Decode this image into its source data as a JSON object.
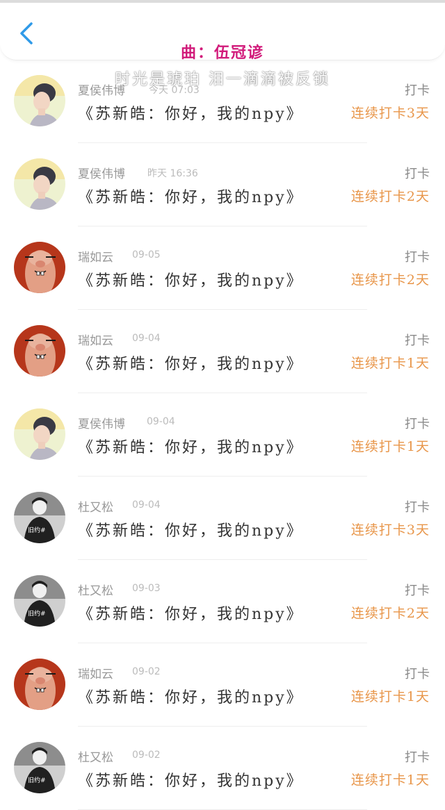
{
  "header": {
    "song_title": "曲：伍冠谚",
    "lyric": "时光是琥珀 泪一滴滴被反锁"
  },
  "rows": [
    {
      "name": "夏侯伟博",
      "time": "今天 07:03",
      "checkin": "打卡",
      "message": "《苏新皓：你好，我的npy》",
      "streak": "连续打卡3天",
      "avatar": "girl"
    },
    {
      "name": "夏侯伟博",
      "time": "昨天 16:36",
      "checkin": "打卡",
      "message": "《苏新皓：你好，我的npy》",
      "streak": "连续打卡2天",
      "avatar": "girl"
    },
    {
      "name": "瑞如云",
      "time": "09-05",
      "checkin": "打卡",
      "message": "《苏新皓：你好，我的npy》",
      "streak": "连续打卡2天",
      "avatar": "finger"
    },
    {
      "name": "瑞如云",
      "time": "09-04",
      "checkin": "打卡",
      "message": "《苏新皓：你好，我的npy》",
      "streak": "连续打卡1天",
      "avatar": "finger"
    },
    {
      "name": "夏侯伟博",
      "time": "09-04",
      "checkin": "打卡",
      "message": "《苏新皓：你好，我的npy》",
      "streak": "连续打卡1天",
      "avatar": "girl"
    },
    {
      "name": "杜又松",
      "time": "09-04",
      "checkin": "打卡",
      "message": "《苏新皓：你好，我的npy》",
      "streak": "连续打卡3天",
      "avatar": "bw",
      "avatar_text": "旧约#"
    },
    {
      "name": "杜又松",
      "time": "09-03",
      "checkin": "打卡",
      "message": "《苏新皓：你好，我的npy》",
      "streak": "连续打卡2天",
      "avatar": "bw",
      "avatar_text": "旧约#"
    },
    {
      "name": "瑞如云",
      "time": "09-02",
      "checkin": "打卡",
      "message": "《苏新皓：你好，我的npy》",
      "streak": "连续打卡1天",
      "avatar": "finger"
    },
    {
      "name": "杜又松",
      "time": "09-02",
      "checkin": "打卡",
      "message": "《苏新皓：你好，我的npy》",
      "streak": "连续打卡1天",
      "avatar": "bw",
      "avatar_text": "旧约#"
    }
  ],
  "colors": {
    "accent": "#2f9ae8",
    "song_title": "#d11a7a",
    "streak": "#e8964a",
    "name": "#999999",
    "message": "#333333"
  },
  "icons": {
    "back": "chevron-left-icon"
  }
}
